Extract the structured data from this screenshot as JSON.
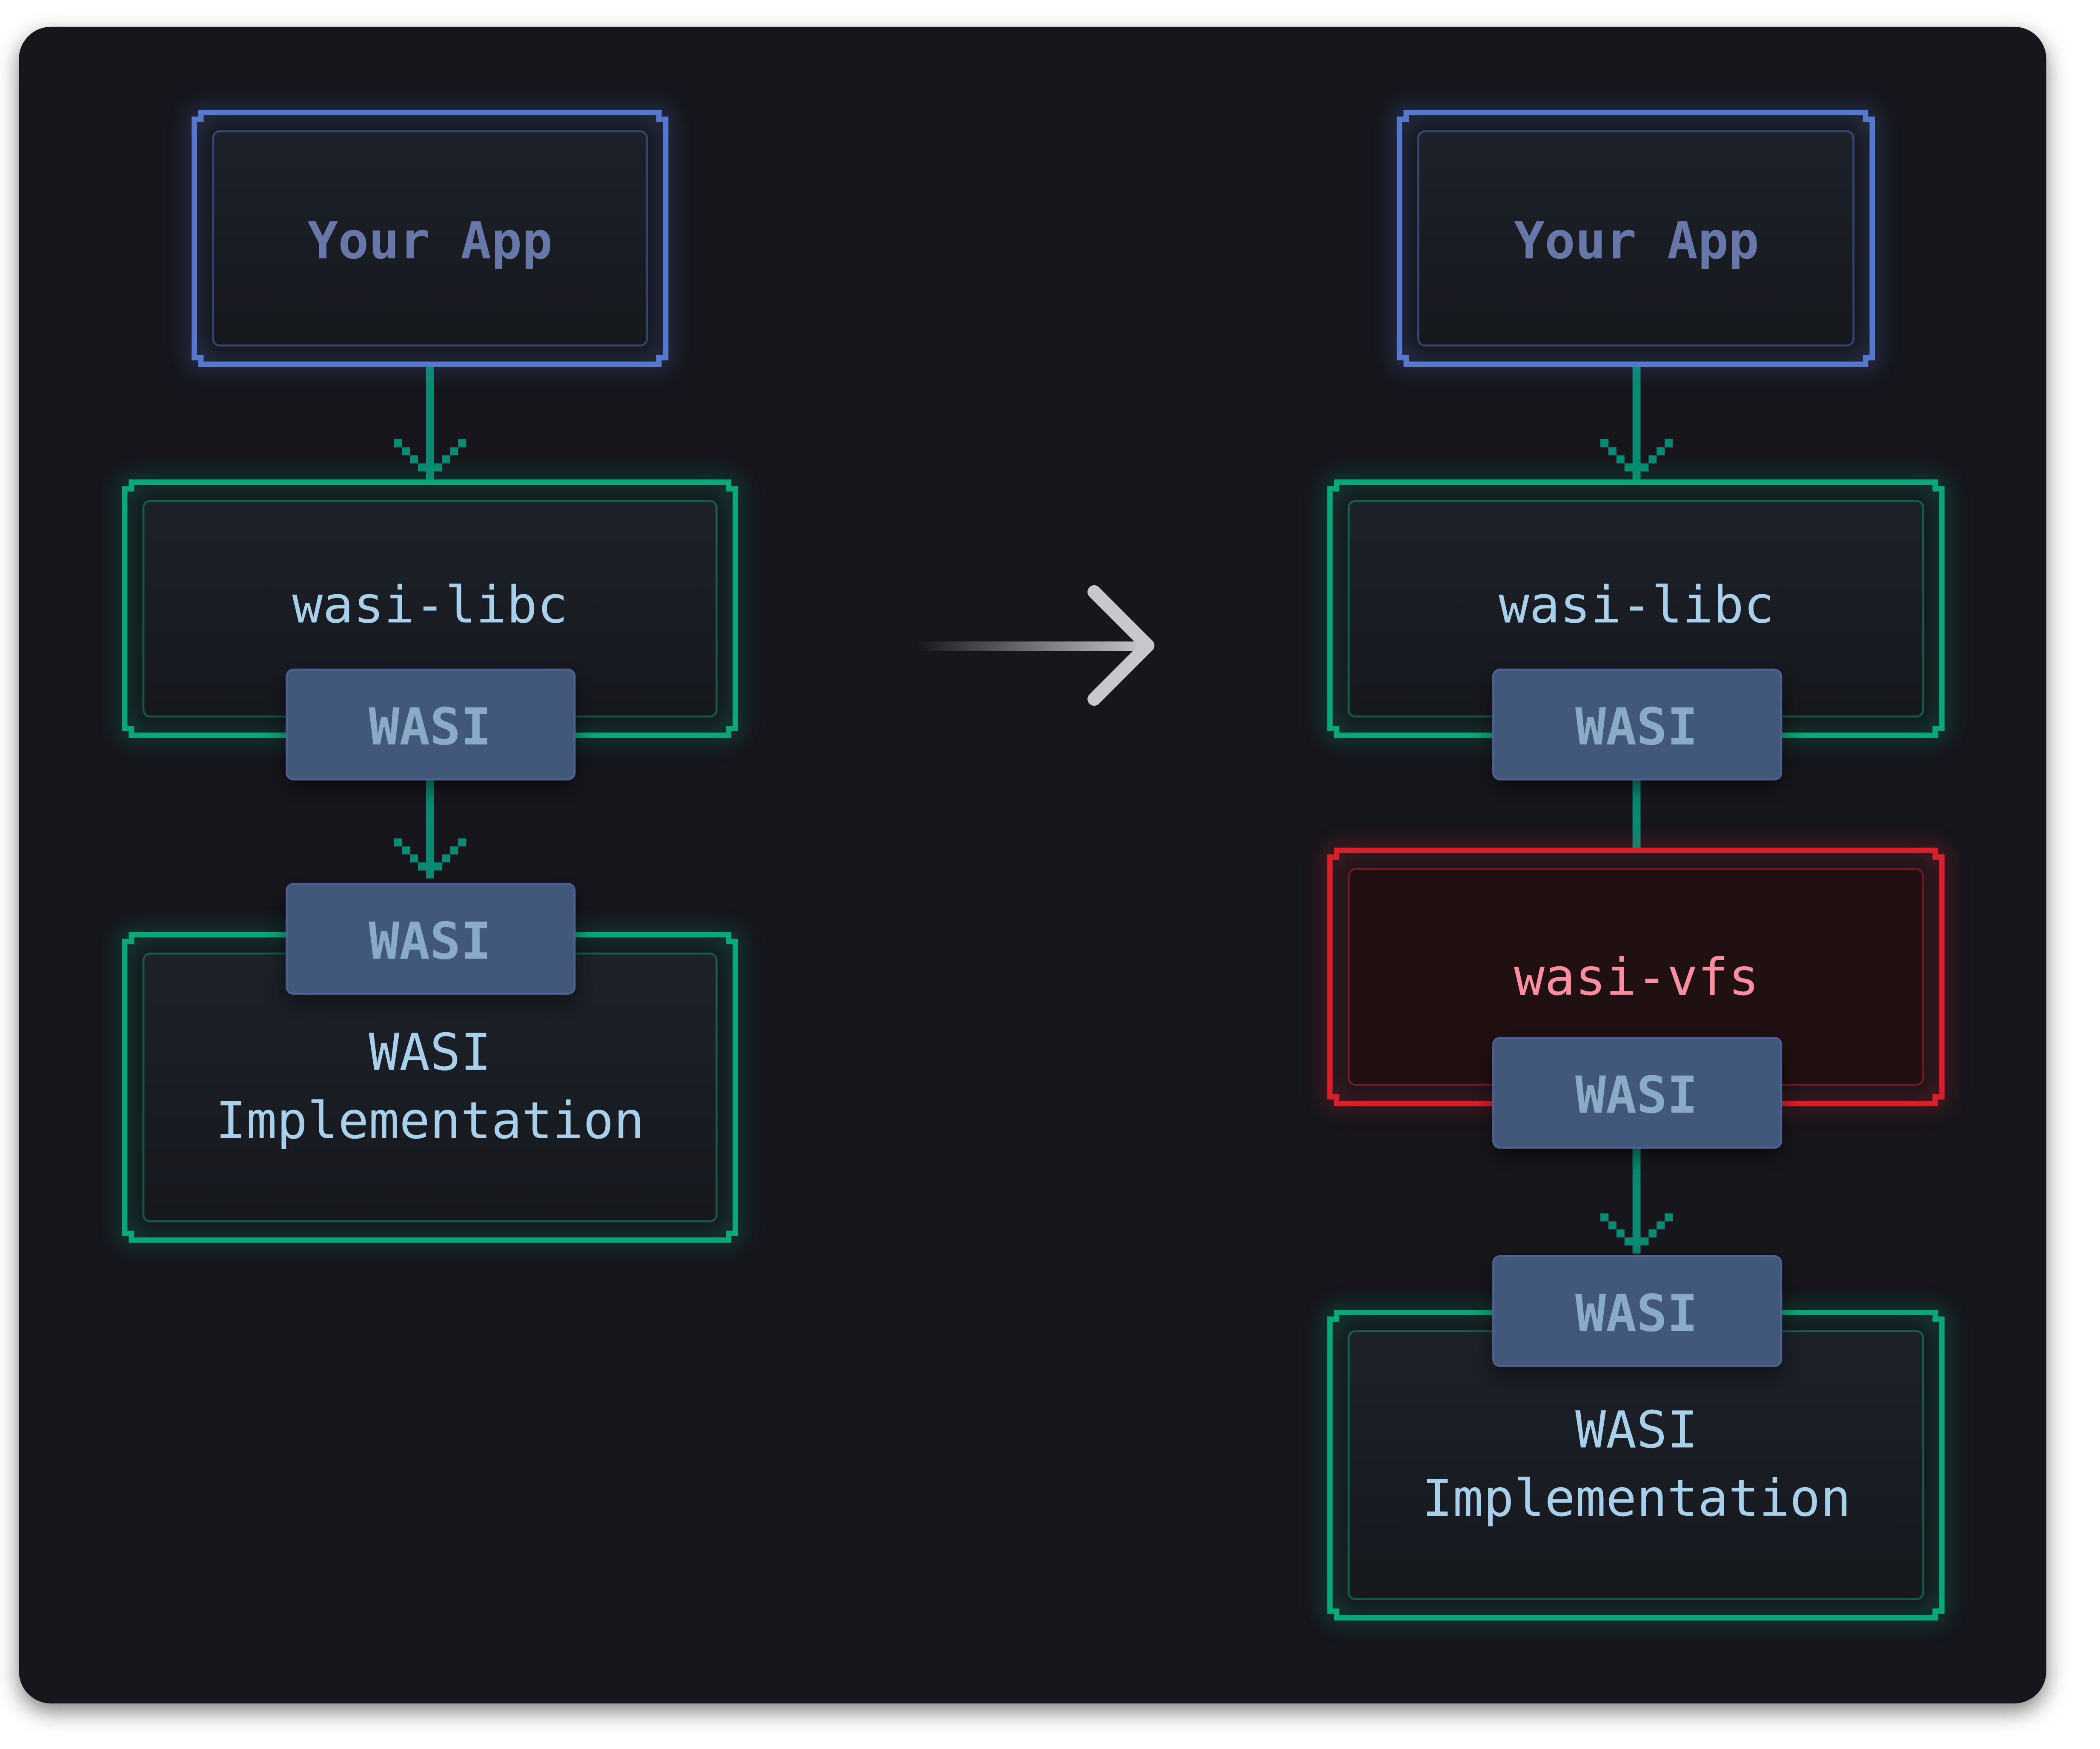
{
  "colors": {
    "background": "#17181d",
    "app_border": "#5577cc",
    "app_text": "#6677a8",
    "libc_border": "#0aa878",
    "libc_text": "#a8d0ea",
    "vfs_border": "#d8202c",
    "vfs_fill": "#211012",
    "vfs_text": "#ff8fa0",
    "badge_fill": "#42587a",
    "badge_text": "#8aabc8",
    "connector": "#0a8a72"
  },
  "before": {
    "app": "Your App",
    "libc": "wasi-libc",
    "libc_badge": "WASI",
    "impl_badge": "WASI",
    "impl_line1": "WASI",
    "impl_line2": "Implementation"
  },
  "transition_icon": "arrow-right-icon",
  "after": {
    "app": "Your App",
    "libc": "wasi-libc",
    "libc_badge": "WASI",
    "vfs": "wasi-vfs",
    "vfs_badge": "WASI",
    "impl_badge": "WASI",
    "impl_line1": "WASI",
    "impl_line2": "Implementation"
  }
}
